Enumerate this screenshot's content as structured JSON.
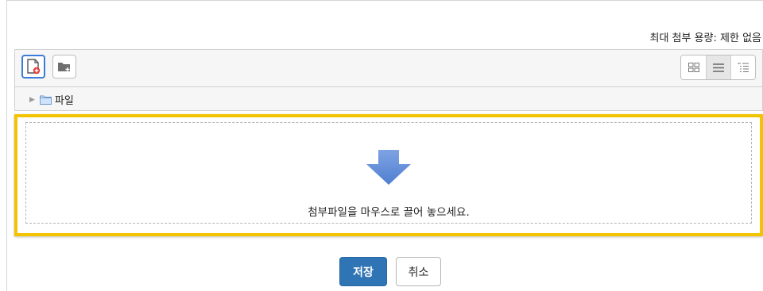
{
  "filepicker": {
    "max_size_text": "최대 첨부 용량: 제한 없음",
    "toolbar": {
      "add_file_icon": "add-file-icon",
      "create_folder_icon": "create-folder-icon",
      "view_modes": [
        "icons-view",
        "list-view",
        "tree-view"
      ],
      "active_view": "list-view"
    },
    "path": {
      "folder_label": "파일"
    },
    "dropzone": {
      "instruction": "첨부파일을 마우스로 끌어 놓으세요."
    }
  },
  "actions": {
    "save_label": "저장",
    "cancel_label": "취소"
  },
  "colors": {
    "highlight_border": "#f2c400",
    "primary_button": "#2f74b5",
    "drop_arrow": "#5b8ad6"
  }
}
